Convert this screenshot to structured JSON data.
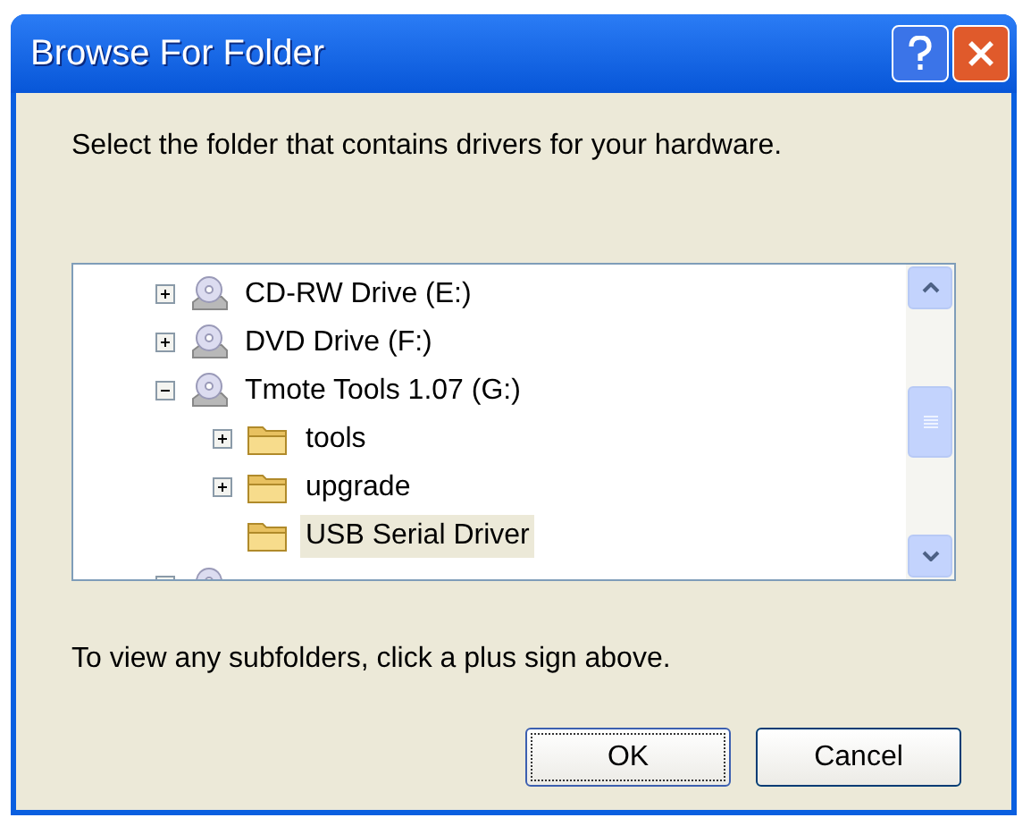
{
  "window": {
    "title": "Browse For Folder"
  },
  "instruction": "Select the folder that contains drivers for your hardware.",
  "tree": [
    {
      "label": "CD-RW Drive (E:)",
      "kind": "drive",
      "expandable": true,
      "expanded": false,
      "selected": false
    },
    {
      "label": "DVD Drive (F:)",
      "kind": "drive",
      "expandable": true,
      "expanded": false,
      "selected": false
    },
    {
      "label": "Tmote Tools 1.07 (G:)",
      "kind": "drive",
      "expandable": true,
      "expanded": true,
      "selected": false,
      "children": [
        {
          "label": "tools",
          "kind": "folder",
          "expandable": true,
          "expanded": false,
          "selected": false
        },
        {
          "label": "upgrade",
          "kind": "folder",
          "expandable": true,
          "expanded": false,
          "selected": false
        },
        {
          "label": "USB Serial Driver",
          "kind": "folder",
          "expandable": false,
          "selected": true
        }
      ]
    }
  ],
  "hint": "To view any subfolders, click a plus sign above.",
  "buttons": [
    {
      "label": "OK",
      "default": true
    },
    {
      "label": "Cancel",
      "default": false
    }
  ]
}
